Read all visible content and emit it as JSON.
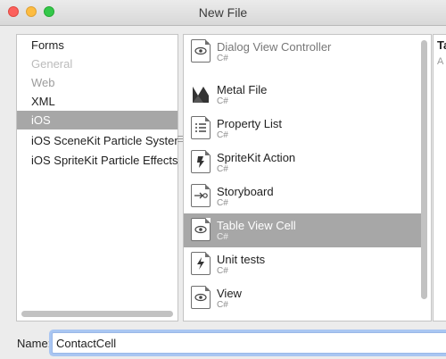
{
  "window": {
    "title": "New File"
  },
  "categories": [
    {
      "label": "Forms",
      "state": "normal"
    },
    {
      "label": "General",
      "state": "faded"
    },
    {
      "label": "Web",
      "state": "disabled"
    },
    {
      "label": "XML",
      "state": "normal"
    },
    {
      "label": "iOS",
      "state": "selected"
    },
    {
      "label": "iOS SceneKit Particle Systems",
      "state": "normal"
    },
    {
      "label": "iOS SpriteKit Particle Effects",
      "state": "normal"
    }
  ],
  "templates": [
    {
      "name": "Dialog View Controller",
      "sub": "C#",
      "icon": "eye-icon",
      "state": "faded"
    },
    {
      "name": "Metal File",
      "sub": "C#",
      "icon": "metal-icon",
      "state": "normal"
    },
    {
      "name": "Property List",
      "sub": "C#",
      "icon": "list-icon",
      "state": "normal"
    },
    {
      "name": "SpriteKit Action",
      "sub": "C#",
      "icon": "sprite-icon",
      "state": "normal"
    },
    {
      "name": "Storyboard",
      "sub": "C#",
      "icon": "storyboard-icon",
      "state": "normal"
    },
    {
      "name": "Table View Cell",
      "sub": "C#",
      "icon": "eye-icon",
      "state": "selected"
    },
    {
      "name": "Unit tests",
      "sub": "C#",
      "icon": "bolt-icon",
      "state": "normal"
    },
    {
      "name": "View",
      "sub": "C#",
      "icon": "eye-icon",
      "state": "normal"
    }
  ],
  "details": {
    "heading": "Ta",
    "sub": "A"
  },
  "name_field": {
    "label": "Name:",
    "value": "ContactCell"
  },
  "colors": {
    "selection": "#a7a7a7",
    "focus_ring": "#a9c6f2"
  }
}
